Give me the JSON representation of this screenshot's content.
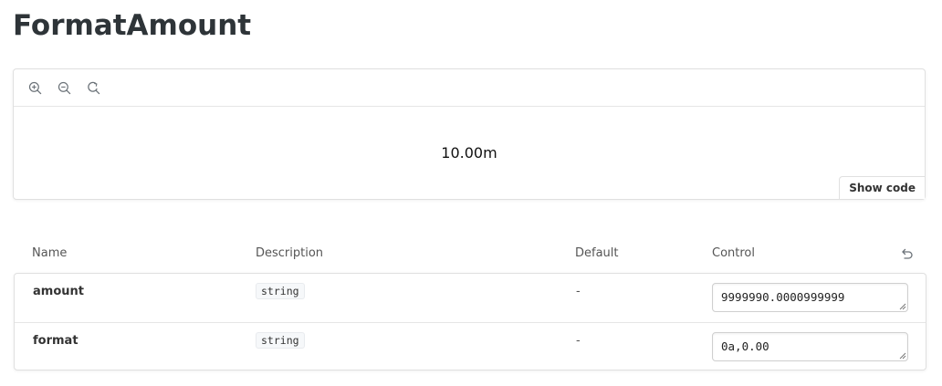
{
  "title": "FormatAmount",
  "preview": {
    "toolbar": {
      "icons": [
        "zoom-in-icon",
        "zoom-out-icon",
        "reset-zoom-icon"
      ]
    },
    "value": "10.00m",
    "show_code_label": "Show code"
  },
  "args_table": {
    "headers": {
      "name": "Name",
      "description": "Description",
      "default": "Default",
      "control": "Control"
    },
    "rows": [
      {
        "name": "amount",
        "type": "string",
        "default": "-",
        "control_value": "9999990.0000999999"
      },
      {
        "name": "format",
        "type": "string",
        "default": "-",
        "control_value": "0a,0.00"
      }
    ]
  },
  "colors": {
    "title": "#2e3438",
    "border": "#e0e0e0",
    "text": "#333333"
  }
}
